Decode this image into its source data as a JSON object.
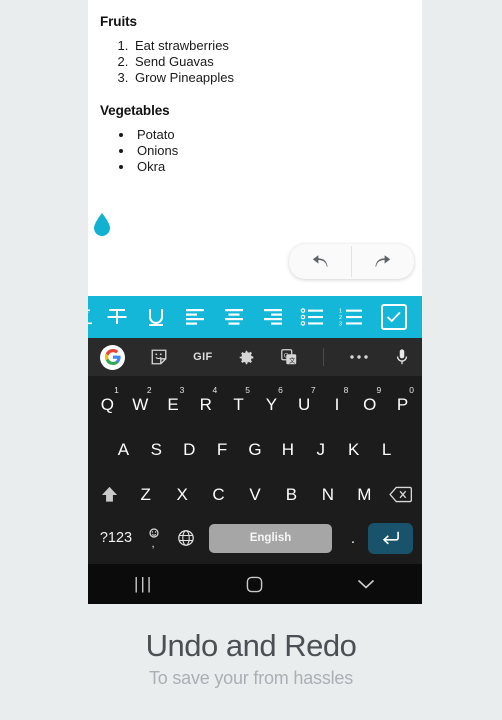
{
  "document": {
    "sections": [
      {
        "heading": "Fruits",
        "list_type": "ordered",
        "items": [
          "Eat strawberries",
          "Send Guavas",
          "Grow Pineapples"
        ]
      },
      {
        "heading": "Vegetables",
        "list_type": "bulleted",
        "items": [
          "Potato",
          "Onions",
          "Okra"
        ]
      }
    ]
  },
  "fab": {
    "name": "droplet-fab",
    "color": "#10b2cf"
  },
  "undo_redo": {
    "undo_label": "Undo",
    "redo_label": "Redo"
  },
  "format_toolbar": {
    "background": "#14b7d7",
    "items": [
      {
        "name": "italic",
        "label": "Italic"
      },
      {
        "name": "strikethrough",
        "label": "Strikethrough"
      },
      {
        "name": "underline",
        "label": "Underline"
      },
      {
        "name": "align-left",
        "label": "Align left"
      },
      {
        "name": "align-center",
        "label": "Align center"
      },
      {
        "name": "align-right",
        "label": "Align right"
      },
      {
        "name": "bullet-list",
        "label": "Bulleted list"
      },
      {
        "name": "numbered-list",
        "label": "Numbered list"
      },
      {
        "name": "checklist",
        "label": "Checklist"
      }
    ]
  },
  "keyboard": {
    "toolbar": [
      {
        "name": "google-logo",
        "label": "G"
      },
      {
        "name": "sticker",
        "label": "Stickers"
      },
      {
        "name": "gif",
        "label": "GIF"
      },
      {
        "name": "settings",
        "label": "Settings"
      },
      {
        "name": "translate",
        "label": "Translate"
      },
      {
        "name": "more",
        "label": "More"
      },
      {
        "name": "mic",
        "label": "Voice input"
      }
    ],
    "row1": [
      {
        "key": "Q",
        "sup": "1"
      },
      {
        "key": "W",
        "sup": "2"
      },
      {
        "key": "E",
        "sup": "3"
      },
      {
        "key": "R",
        "sup": "4"
      },
      {
        "key": "T",
        "sup": "5"
      },
      {
        "key": "Y",
        "sup": "6"
      },
      {
        "key": "U",
        "sup": "7"
      },
      {
        "key": "I",
        "sup": "8"
      },
      {
        "key": "O",
        "sup": "9"
      },
      {
        "key": "P",
        "sup": "0"
      }
    ],
    "row2": [
      "A",
      "S",
      "D",
      "F",
      "G",
      "H",
      "J",
      "K",
      "L"
    ],
    "row3": [
      "Z",
      "X",
      "C",
      "V",
      "B",
      "N",
      "M"
    ],
    "row4": {
      "symbols": "?123",
      "comma": ",",
      "globe": "Languages",
      "space": "English",
      "period": ".",
      "enter": "Enter"
    },
    "shift_label": "Shift",
    "backspace_label": "Backspace"
  },
  "nav_bar": {
    "recents": "|||",
    "home": "Home",
    "dismiss": "Hide keyboard"
  },
  "caption": {
    "title": "Undo and Redo",
    "subtitle": "To save your from hassles"
  }
}
